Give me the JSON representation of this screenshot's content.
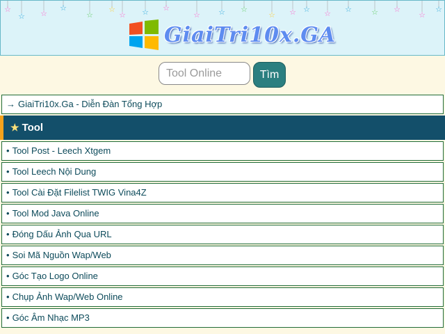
{
  "header": {
    "logo_text": "GiaiTri10x.GA",
    "colors": {
      "background": "#dcf3f9",
      "logo": "#5e8cf0"
    }
  },
  "search": {
    "placeholder": "Tool Online",
    "value": "",
    "button_label": "Tìm"
  },
  "nav": {
    "breadcrumb": "GiaiTri10x.Ga - Diễn Đàn Tổng Hợp"
  },
  "section": {
    "title": "Tool",
    "colors": {
      "background": "#134f6a",
      "accent": "#f6a21c"
    }
  },
  "items": [
    {
      "label": "Tool Post - Leech Xtgem"
    },
    {
      "label": "Tool Leech Nội Dung"
    },
    {
      "label": "Tool Cài Đặt Filelist TWIG Vina4Z"
    },
    {
      "label": "Tool Mod Java Online"
    },
    {
      "label": "Đóng Dấu Ảnh Qua URL"
    },
    {
      "label": "Soi Mã Nguồn Wap/Web"
    },
    {
      "label": "Góc Tạo Logo Online"
    },
    {
      "label": "Chụp Ảnh Wap/Web Online"
    },
    {
      "label": "Góc Âm Nhạc MP3"
    }
  ]
}
